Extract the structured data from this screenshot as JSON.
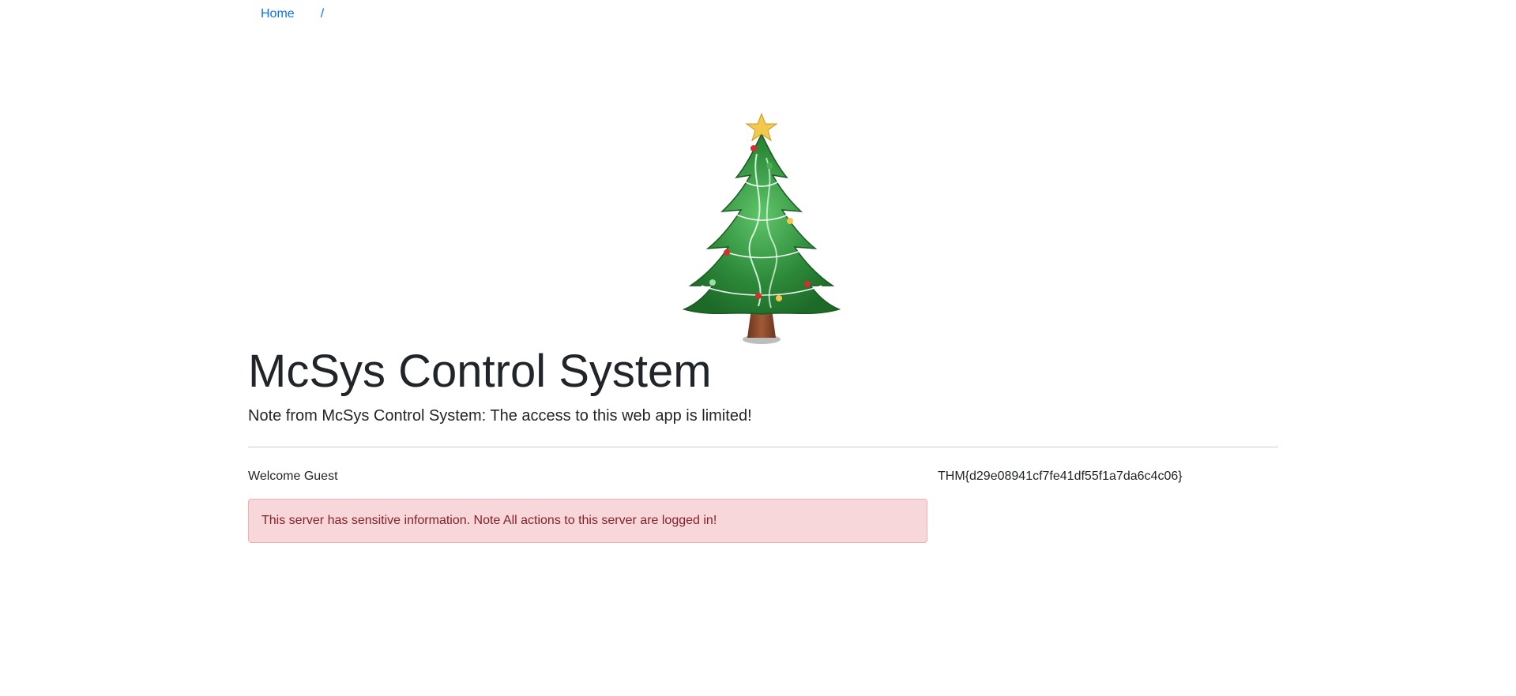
{
  "breadcrumb": {
    "home_label": "Home",
    "separator": "/"
  },
  "header": {
    "title": "McSys Control System",
    "note": "Note from McSys Control System: The access to this web app is limited!"
  },
  "main": {
    "welcome_text": "Welcome Guest",
    "flag_text": "THM{d29e08941cf7fe41df55f1a7da6c4c06}",
    "alert_text": "This server has sensitive information. Note All actions to this server are logged in!"
  },
  "colors": {
    "link": "#0d6efd",
    "alert_bg": "#f8d7da",
    "alert_text": "#842029",
    "tree_green": "#2e8b3a",
    "trunk": "#8b4a2b",
    "star": "#f2c94c"
  },
  "icons": {
    "tree": "christmas-tree-illustration"
  }
}
